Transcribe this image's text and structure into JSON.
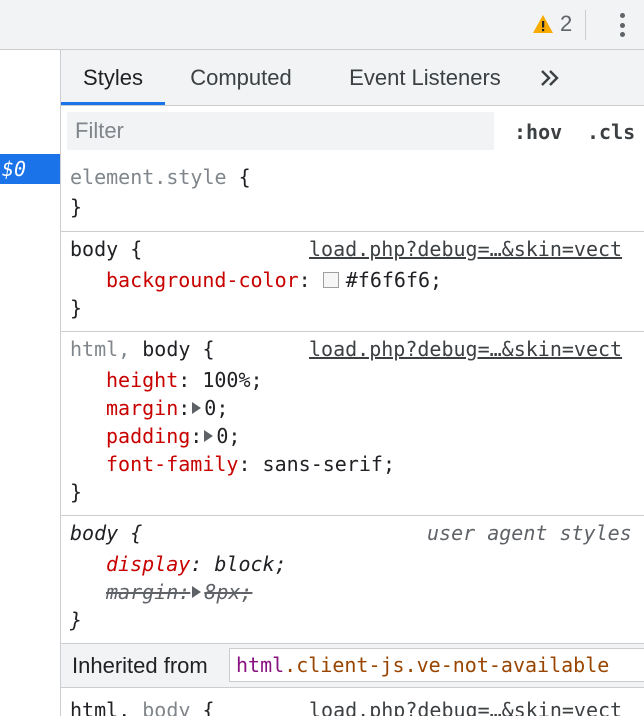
{
  "toolbar": {
    "warning_count": "2",
    "icons": [
      "warning-icon",
      "more-options-icon"
    ]
  },
  "elements": {
    "selected_ref": "$0"
  },
  "tabs": [
    {
      "label": "Styles",
      "active": true
    },
    {
      "label": "Computed",
      "active": false
    },
    {
      "label": "Event Listeners",
      "active": false
    }
  ],
  "filter": {
    "placeholder": "Filter",
    "hov_label": ":hov",
    "cls_label": ".cls"
  },
  "rules": {
    "element_style": {
      "selector": "element.style",
      "open": " {",
      "close": "}"
    },
    "body_bg": {
      "selector": "body",
      "open": " {",
      "source": "load.php?debug=…&skin=vect",
      "decls": [
        {
          "prop": "background-color",
          "value": "#f6f6f6"
        }
      ],
      "close": "}"
    },
    "html_body": {
      "selector_dim": "html,",
      "selector": " body",
      "open": " {",
      "source": "load.php?debug=…&skin=vect",
      "decls": [
        {
          "prop": "height",
          "value": "100%"
        },
        {
          "prop": "margin",
          "value": "0"
        },
        {
          "prop": "padding",
          "value": "0"
        },
        {
          "prop": "font-family",
          "value": "sans-serif"
        }
      ],
      "close": "}"
    },
    "ua_body": {
      "selector": "body",
      "open": " {",
      "source": "user agent styles",
      "decls": [
        {
          "prop": "display",
          "value": "block"
        },
        {
          "prop": "margin",
          "value": "8px"
        }
      ],
      "close": "}"
    },
    "html_body_2": {
      "selector": "html,",
      "selector_dim": " body",
      "open": " {",
      "source": "load.php?debug=…&skin=vect"
    }
  },
  "inherited": {
    "label": "Inherited from",
    "tag": "html",
    "classes": ".client-js.ve-not-available"
  },
  "colors": {
    "accent": "#1a73e8",
    "warning": "#f9ab00",
    "property": "#c80000",
    "swatch": "#f6f6f6"
  }
}
